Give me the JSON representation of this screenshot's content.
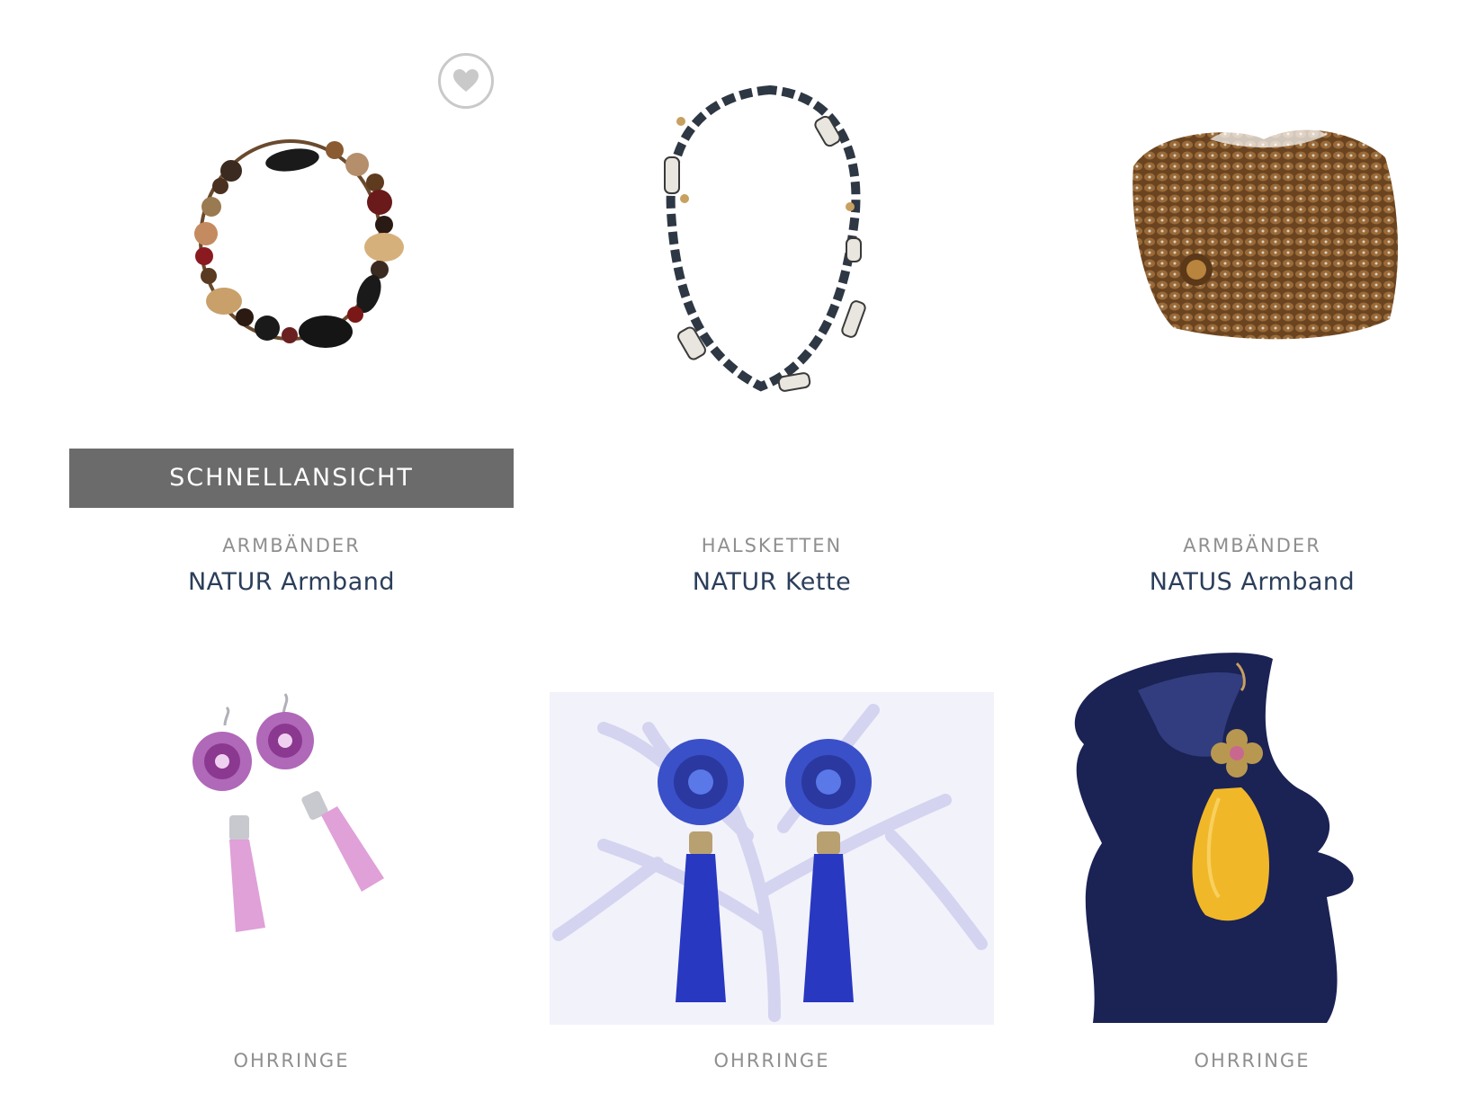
{
  "quickview": {
    "label": "SCHNELLANSICHT"
  },
  "products": [
    {
      "category": "ARMBÄNDER",
      "title": "NATUR Armband",
      "image_icon": "beaded-bracelet-image"
    },
    {
      "category": "HALSKETTEN",
      "title": "NATUR Kette",
      "image_icon": "beaded-necklace-image"
    },
    {
      "category": "ARMBÄNDER",
      "title": "NATUS Armband",
      "image_icon": "wooden-cuff-bracelet-image"
    },
    {
      "category": "OHRRINGE",
      "image_icon": "pink-tassel-earrings-image"
    },
    {
      "category": "OHRRINGE",
      "image_icon": "blue-tassel-earrings-image"
    },
    {
      "category": "OHRRINGE",
      "image_icon": "yellow-feather-earring-image"
    }
  ],
  "colors": {
    "category_text": "#8f8f8f",
    "title_text": "#2b3e5a",
    "quickview_bg": "#6b6b6b",
    "wishlist_icon": "#c9c9c9"
  }
}
